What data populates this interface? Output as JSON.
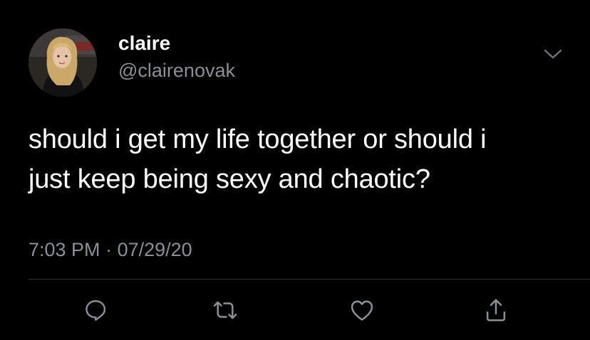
{
  "author": {
    "display_name": "claire",
    "handle": "@clairenovak",
    "avatar_icon": "profile-photo"
  },
  "tweet": {
    "text_lines": [
      "should i get my life together or should i",
      "just keep being sexy and chaotic?"
    ],
    "time": "7:03 PM",
    "separator": "·",
    "date": "07/29/20"
  },
  "actions": {
    "reply_icon": "speech-bubble-icon",
    "retweet_icon": "retweet-icon",
    "like_icon": "heart-icon",
    "share_icon": "share-icon",
    "more_icon": "chevron-down-icon"
  },
  "colors": {
    "background": "#000000",
    "primary_text": "#ffffff",
    "secondary_text": "#8b8f94",
    "divider": "#2f3336"
  }
}
